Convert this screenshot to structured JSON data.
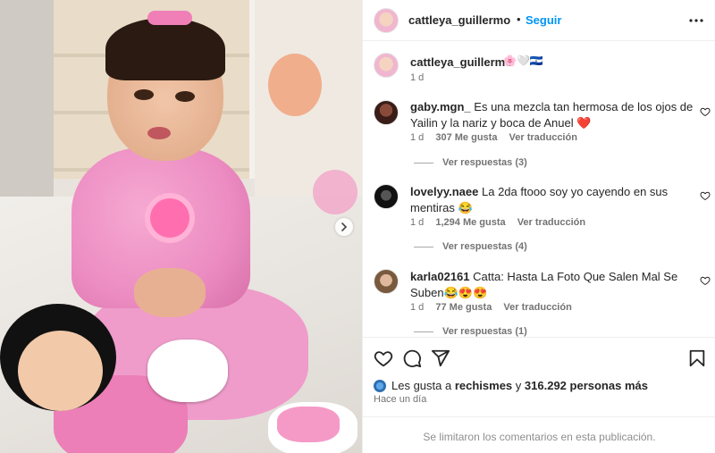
{
  "post": {
    "username": "cattleya_guillermo",
    "follow_label": "Seguir",
    "dot": "•",
    "caption_emoji": "🌸🤍🇸🇻",
    "caption_time": "1 d"
  },
  "comments": [
    {
      "user": "gaby.mgn_",
      "text": "Es una mezcla tan hermosa de los ojos de Yailin y la nariz y boca de Anuel ❤️",
      "time": "1 d",
      "likes": "307 Me gusta",
      "translate": "Ver traducción",
      "replies": "Ver respuestas (3)"
    },
    {
      "user": "lovelyy.naee",
      "text": "La 2da ftooo soy yo cayendo en sus mentiras 😂",
      "time": "1 d",
      "likes": "1,294 Me gusta",
      "translate": "Ver traducción",
      "replies": "Ver respuestas (4)"
    },
    {
      "user": "karla02161",
      "text": "Catta: Hasta La Foto Que Salen Mal Se Suben😂😍😍",
      "time": "1 d",
      "likes": "77 Me gusta",
      "translate": "Ver traducción",
      "replies": "Ver respuestas (1)"
    }
  ],
  "likes": {
    "prefix": "Les gusta a",
    "user": "rechismes",
    "and": "y",
    "count": "316.292 personas más"
  },
  "time_ago": "Hace un día",
  "comments_limited": "Se limitaron los comentarios en esta publicación.",
  "icons": {
    "more": "more-horizontal-icon",
    "heart": "heart-icon",
    "comment": "comment-icon",
    "share": "share-icon",
    "save": "bookmark-icon",
    "next": "chevron-right-icon"
  },
  "colors": {
    "accent": "#0095f6",
    "heart_red": "#ed4956",
    "muted": "#737373"
  }
}
